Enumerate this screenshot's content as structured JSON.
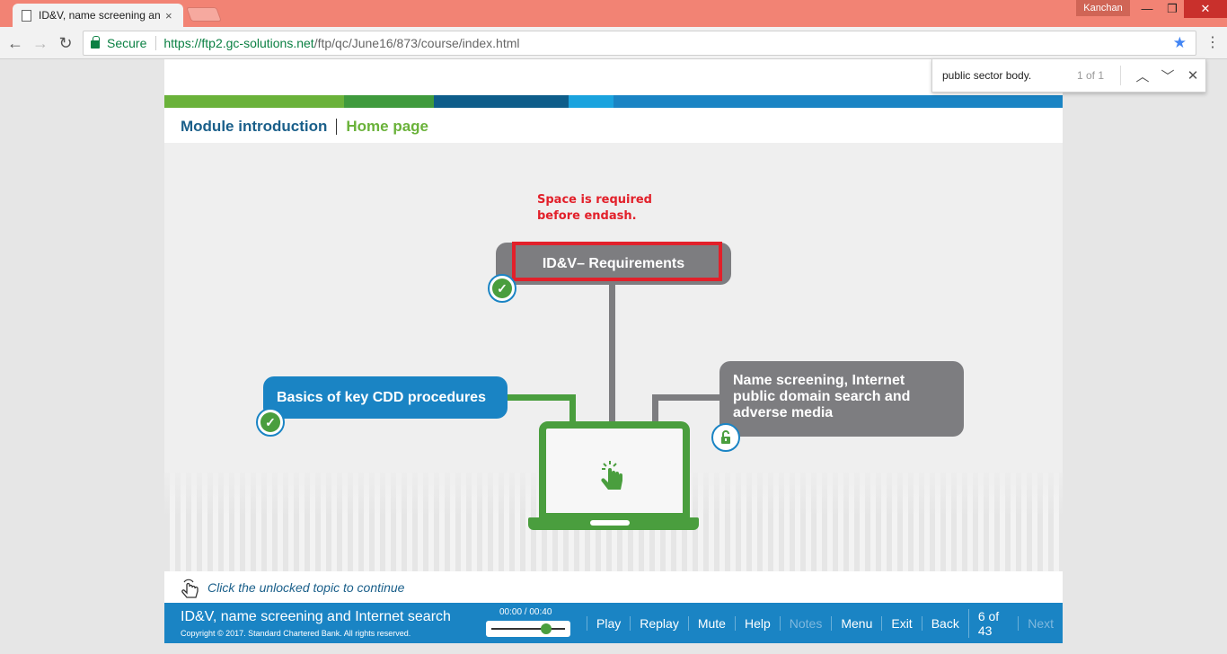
{
  "browser": {
    "tab_title": "ID&V, name screening an",
    "tab_close": "×",
    "user": "Kanchan",
    "win_min": "—",
    "win_max": "❐",
    "win_close": "✕",
    "secure_label": "Secure",
    "url_host": "https://ftp2.gc-solutions.net",
    "url_path": "/ftp/qc/June16/873/course/index.html",
    "find_query": "public sector body.",
    "find_count": "1 of 1"
  },
  "course": {
    "stripe_colors": [
      "#6ab23a",
      "#3f9a3d",
      "#0e5d8a",
      "#1aa3de",
      "#1a84c4"
    ],
    "nav": {
      "module": "Module introduction",
      "home": "Home page"
    },
    "note": "Space is required before endash.",
    "topics": {
      "requirements": "ID&V– Requirements",
      "basics": "Basics of key CDD procedures",
      "name_screening": "Name screening, Internet public domain search and adverse media"
    },
    "instruction": "Click the unlocked topic to continue",
    "footer": {
      "title": "ID&V, name screening and Internet search",
      "copyright": "Copyright © 2017. Standard Chartered Bank. All rights reserved.",
      "time": "00:00 / 00:40",
      "progress": 0.74,
      "buttons": {
        "play": "Play",
        "replay": "Replay",
        "mute": "Mute",
        "help": "Help",
        "notes": "Notes",
        "menu": "Menu",
        "exit": "Exit",
        "back": "Back",
        "page": "6 of 43",
        "next": "Next"
      }
    },
    "colors": {
      "accent_blue": "#1a84c4",
      "accent_green": "#4a9e3e",
      "grey_box": "#7d7d80",
      "annotation_red": "#e2202a"
    }
  }
}
